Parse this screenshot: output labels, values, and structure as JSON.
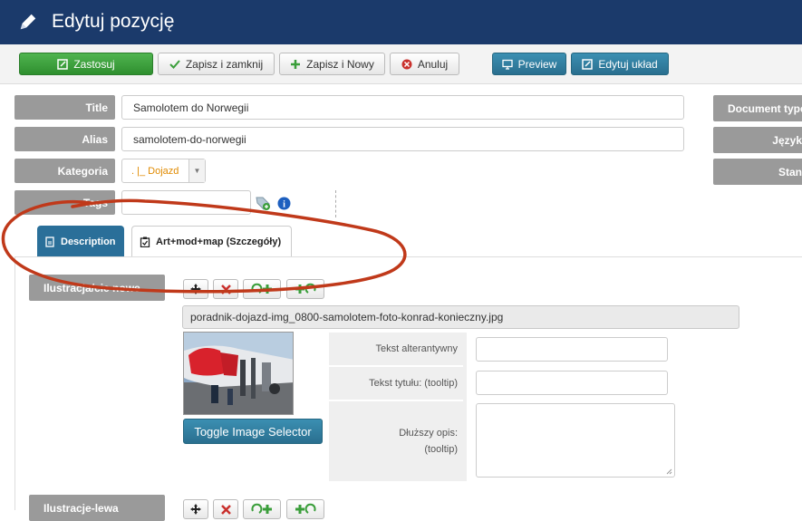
{
  "window": {
    "title": "Edytuj pozycję"
  },
  "toolbar": {
    "apply": "Zastosuj",
    "save_close": "Zapisz i zamknij",
    "save_new": "Zapisz i Nowy",
    "cancel": "Anuluj",
    "preview": "Preview",
    "edit_layout": "Edytuj układ"
  },
  "form": {
    "title_label": "Title",
    "title_value": "Samolotem do Norwegii",
    "alias_label": "Alias",
    "alias_value": "samolotem-do-norwegii",
    "category_label": "Kategoria",
    "category_value": ". |_ Dojazd",
    "tags_label": "Tags"
  },
  "right_panel": {
    "document_type": "Document type",
    "language": "Język",
    "state": "Stan"
  },
  "tabs": [
    {
      "label": "Description"
    },
    {
      "label": "Art+mod+map (Szczegóły)"
    }
  ],
  "section1": {
    "label": "Ilustracja/cie nowe",
    "filename": "poradnik-dojazd-img_0800-samolotem-foto-konrad-konieczny.jpg",
    "alt_label": "Tekst alterantywny",
    "title_label": "Tekst tytułu: (tooltip)",
    "desc_label": "Dłuższy opis: (tooltip)",
    "toggle_button": "Toggle Image Selector"
  },
  "section2": {
    "label": "Ilustracje-lewa"
  },
  "colors": {
    "header_bg": "#1b3a6b",
    "apply_green": "#3a9e3a",
    "blue_button": "#2a7fa3",
    "label_gray": "#9a9a9a",
    "annotation_red": "#c0391a"
  }
}
